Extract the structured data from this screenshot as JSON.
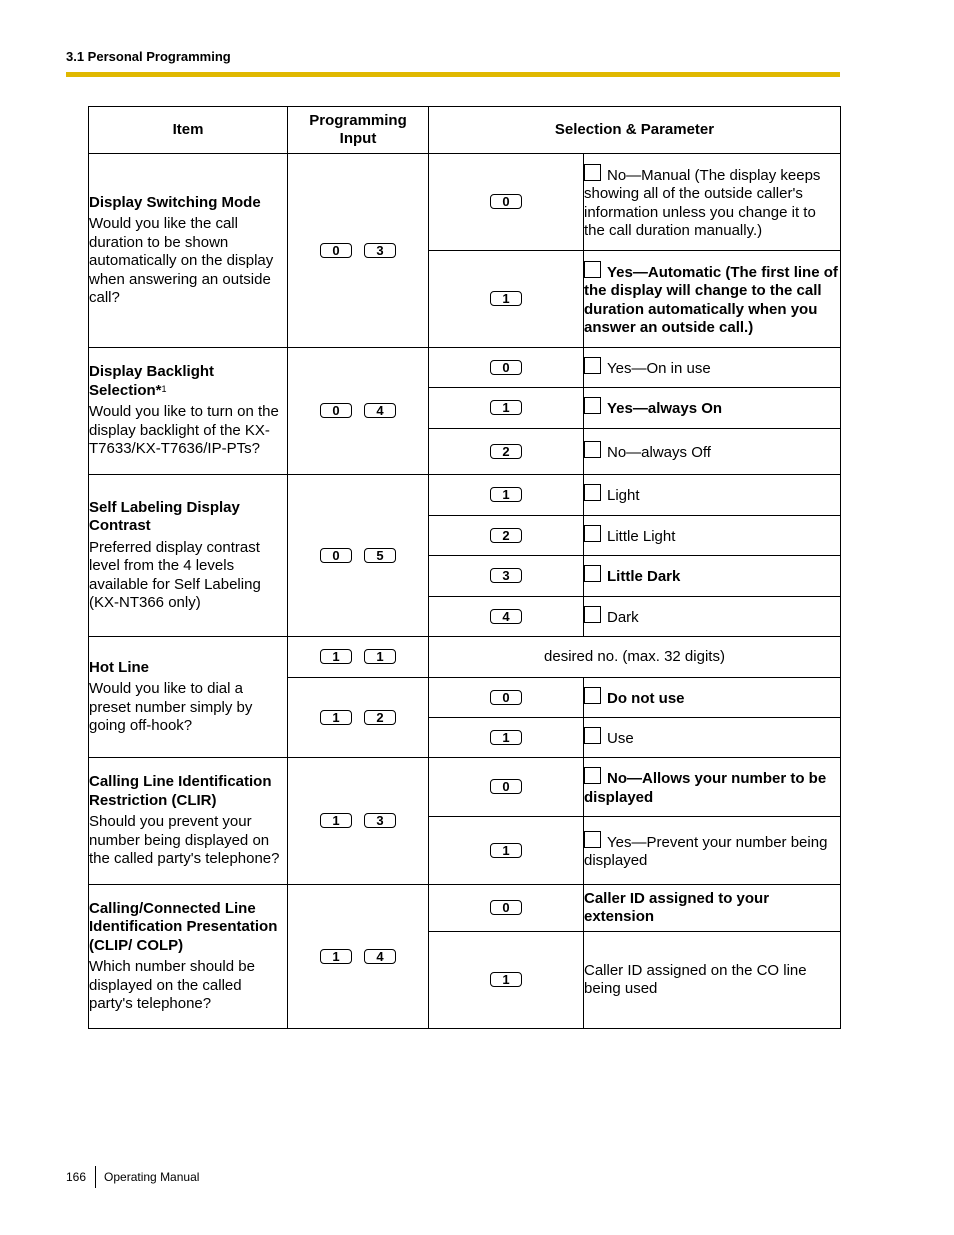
{
  "header": {
    "section_title": "3.1 Personal Programming",
    "rule_color": "#e0b800"
  },
  "table": {
    "columns": [
      "Item",
      "Programming Input",
      "Selection & Parameter"
    ],
    "rows": [
      {
        "title": "Display Switching Mode",
        "footnote": "",
        "description": "Would you like the call duration to be shown automatically on the display when answering an outside call?",
        "keys": [
          "0",
          "3"
        ],
        "options": [
          {
            "key": "0",
            "label": "No—Manual (The display keeps showing all of the outside caller's information unless you change it to the call duration manually.)",
            "bold": false,
            "checkbox": true
          },
          {
            "key": "1",
            "label": "Yes—Automatic (The first line of the display will change to the call duration automatically when you answer an outside call.)",
            "bold": true,
            "checkbox": true
          }
        ]
      },
      {
        "title": "Display Backlight Selection*",
        "footnote": "1",
        "description": "Would you like to turn on the display backlight of the KX-T7633/KX-T7636/IP-PTs?",
        "keys": [
          "0",
          "4"
        ],
        "options": [
          {
            "key": "0",
            "label": "Yes—On in use",
            "bold": false,
            "checkbox": true
          },
          {
            "key": "1",
            "label": "Yes—always On",
            "bold": true,
            "checkbox": true
          },
          {
            "key": "2",
            "label": "No—always Off",
            "bold": false,
            "checkbox": true
          }
        ]
      },
      {
        "title": "Self Labeling Display Contrast",
        "footnote": "",
        "description": "Preferred display contrast level from the 4 levels available for Self Labeling (KX-NT366 only)",
        "keys": [
          "0",
          "5"
        ],
        "options": [
          {
            "key": "1",
            "label": "Light",
            "bold": false,
            "checkbox": true
          },
          {
            "key": "2",
            "label": "Little Light",
            "bold": false,
            "checkbox": true
          },
          {
            "key": "3",
            "label": "Little Dark",
            "bold": true,
            "checkbox": true
          },
          {
            "key": "4",
            "label": "Dark",
            "bold": false,
            "checkbox": true
          }
        ]
      },
      {
        "title": "Hot Line",
        "footnote": "",
        "description": "Would you like to dial a preset number simply by going off-hook?",
        "sub": [
          {
            "keys": [
              "1",
              "1"
            ],
            "parameter": "desired no. (max. 32 digits)"
          },
          {
            "keys": [
              "1",
              "2"
            ],
            "options": [
              {
                "key": "0",
                "label": "Do not use",
                "bold": true,
                "checkbox": true
              },
              {
                "key": "1",
                "label": "Use",
                "bold": false,
                "checkbox": true
              }
            ]
          }
        ]
      },
      {
        "title": "Calling Line Identification Restriction (CLIR)",
        "footnote": "",
        "description": "Should you prevent your number being displayed on the called party's telephone?",
        "keys": [
          "1",
          "3"
        ],
        "options": [
          {
            "key": "0",
            "label": "No—Allows your number to be displayed",
            "bold": true,
            "checkbox": true
          },
          {
            "key": "1",
            "label": "Yes—Prevent your number being displayed",
            "bold": false,
            "checkbox": true
          }
        ]
      },
      {
        "title": "Calling/Connected Line Identification Presentation (CLIP/ COLP)",
        "footnote": "",
        "description": "Which number should be displayed on the called party's telephone?",
        "keys": [
          "1",
          "4"
        ],
        "options": [
          {
            "key": "0",
            "label": "Caller ID assigned to your extension",
            "bold": true,
            "checkbox": false
          },
          {
            "key": "1",
            "label": "Caller ID assigned on the CO line being used",
            "bold": false,
            "checkbox": false
          }
        ]
      }
    ]
  },
  "footer": {
    "page_number": "166",
    "manual_title": "Operating Manual"
  }
}
